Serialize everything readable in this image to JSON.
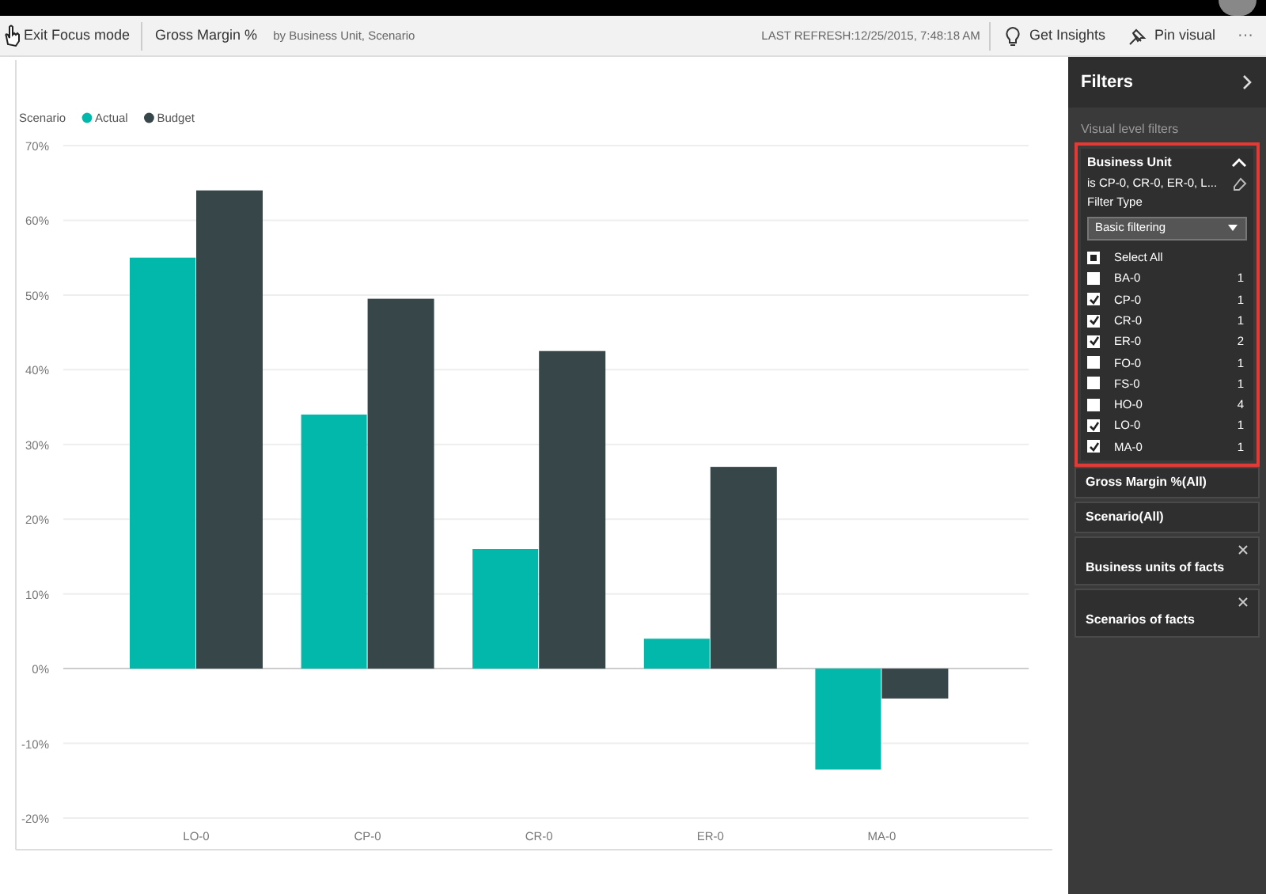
{
  "toolbar": {
    "exit_label": "Exit Focus mode",
    "visual_title": "Gross Margin %",
    "subtitle": "by Business Unit, Scenario",
    "last_refresh": "LAST REFRESH:12/25/2015, 7:48:18 AM",
    "actions": [
      "Get Insights",
      "Pin visual"
    ],
    "more": "···"
  },
  "chart": {
    "legend_title": "Scenario",
    "chart_data": {
      "type": "bar",
      "categories": [
        "LO-0",
        "CP-0",
        "CR-0",
        "ER-0",
        "MA-0"
      ],
      "series": [
        {
          "name": "Actual",
          "color": "#01b8aa",
          "values": [
            0.55,
            0.34,
            0.16,
            0.04,
            -0.135
          ]
        },
        {
          "name": "Budget",
          "color": "#374649",
          "values": [
            0.64,
            0.495,
            0.425,
            0.27,
            -0.04
          ]
        }
      ],
      "ylim": [
        -0.2,
        0.7
      ],
      "grid": true,
      "legend": true,
      "yticks": [
        {
          "value": 0.7,
          "label": "70%"
        },
        {
          "value": 0.6,
          "label": "60%"
        },
        {
          "value": 0.5,
          "label": "50%"
        },
        {
          "value": 0.4,
          "label": "40%"
        },
        {
          "value": 0.3,
          "label": "30%"
        },
        {
          "value": 0.2,
          "label": "20%"
        },
        {
          "value": 0.1,
          "label": "10%"
        },
        {
          "value": 0,
          "label": "0%"
        },
        {
          "value": -0.1,
          "label": "-10%"
        },
        {
          "value": -0.2,
          "label": "-20%"
        }
      ]
    }
  },
  "filters": {
    "title": "Filters",
    "section": "Visual level filters",
    "active_filter": {
      "field": "Business Unit",
      "expanded": true,
      "summary": "is CP-0, CR-0, ER-0, L...",
      "type_label": "Filter Type",
      "type_value": "Basic filtering",
      "select_all": {
        "label": "Select All",
        "indeterminate": true
      },
      "items": [
        {
          "label": "BA-0",
          "count": "1",
          "checked": false
        },
        {
          "label": "CP-0",
          "count": "1",
          "checked": true
        },
        {
          "label": "CR-0",
          "count": "1",
          "checked": true
        },
        {
          "label": "ER-0",
          "count": "2",
          "checked": true
        },
        {
          "label": "FO-0",
          "count": "1",
          "checked": false
        },
        {
          "label": "FS-0",
          "count": "1",
          "checked": false
        },
        {
          "label": "HO-0",
          "count": "4",
          "checked": false
        },
        {
          "label": "LO-0",
          "count": "1",
          "checked": true
        },
        {
          "label": "MA-0",
          "count": "1",
          "checked": true
        }
      ]
    },
    "other_filters": [
      {
        "label": "Gross Margin %(All)",
        "removable": false
      },
      {
        "label": "Scenario(All)",
        "removable": false
      },
      {
        "label": "Business units of facts",
        "removable": true
      },
      {
        "label": "Scenarios of facts",
        "removable": true
      }
    ]
  }
}
